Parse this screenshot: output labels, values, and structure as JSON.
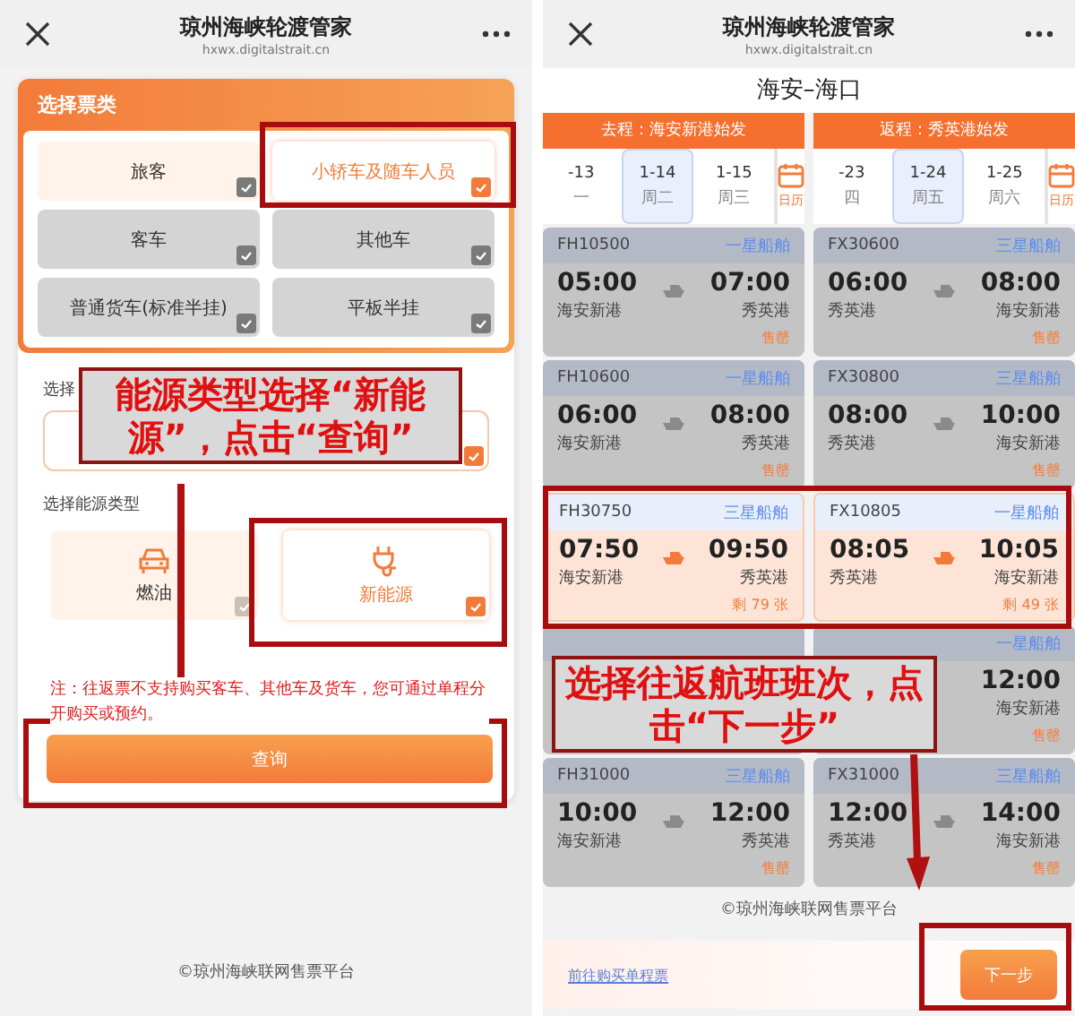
{
  "left": {
    "header": {
      "title": "琼州海峡轮渡管家",
      "subtitle": "hxwx.digitalstrait.cn"
    },
    "ticket_section": {
      "title": "选择票类",
      "options": [
        {
          "label": "旅客",
          "selected": false,
          "disabled": false
        },
        {
          "label": "小轿车及随车人员",
          "selected": true,
          "disabled": false
        },
        {
          "label": "客车",
          "selected": false,
          "disabled": true
        },
        {
          "label": "其他车",
          "selected": false,
          "disabled": true
        },
        {
          "label": "普通货车(标准半挂)",
          "selected": false,
          "disabled": true
        },
        {
          "label": "平板半挂",
          "selected": false,
          "disabled": true
        }
      ]
    },
    "vehicle_label": "选择",
    "energy_label": "选择能源类型",
    "energy_options": [
      {
        "kind": "fuel",
        "label": "燃油",
        "selected": false
      },
      {
        "kind": "electric",
        "label": "新能源",
        "selected": true
      }
    ],
    "note": "注：往返票不支持购买客车、其他车及货车，您可通过单程分开购买或预约。",
    "query_button": "查询",
    "footer": "©琼州海峡联网售票平台"
  },
  "right": {
    "header": {
      "title": "琼州海峡轮渡管家",
      "subtitle": "hxwx.digitalstrait.cn"
    },
    "route_title": "海安–海口",
    "columns": [
      {
        "route": "去程：海安新港始发",
        "calendar": "日历",
        "dates": [
          {
            "date": "-13",
            "weekday": "一",
            "selected": false
          },
          {
            "date": "1-14",
            "weekday": "周二",
            "selected": true
          },
          {
            "date": "1-15",
            "weekday": "周三",
            "selected": false
          }
        ],
        "trips": [
          {
            "number": "FH10500",
            "grade": "一星船舶",
            "depart_time": "05:00",
            "depart_port": "海安新港",
            "arrive_time": "07:00",
            "arrive_port": "秀英港",
            "status": "售罄",
            "sold_out": true,
            "selected": false
          },
          {
            "number": "FH10600",
            "grade": "一星船舶",
            "depart_time": "06:00",
            "depart_port": "海安新港",
            "arrive_time": "08:00",
            "arrive_port": "秀英港",
            "status": "售罄",
            "sold_out": true,
            "selected": false
          },
          {
            "number": "FH30750",
            "grade": "三星船舶",
            "depart_time": "07:50",
            "depart_port": "海安新港",
            "arrive_time": "09:50",
            "arrive_port": "秀英港",
            "status": "剩 79 张",
            "sold_out": false,
            "selected": true
          },
          {
            "sold_out": true,
            "selected": false
          },
          {
            "number": "FH31000",
            "grade": "三星船舶",
            "depart_time": "10:00",
            "depart_port": "海安新港",
            "arrive_time": "12:00",
            "arrive_port": "秀英港",
            "status": "售罄",
            "sold_out": true,
            "selected": false
          }
        ]
      },
      {
        "route": "返程：秀英港始发",
        "calendar": "日历",
        "dates": [
          {
            "date": "-23",
            "weekday": "四",
            "selected": false
          },
          {
            "date": "1-24",
            "weekday": "周五",
            "selected": true
          },
          {
            "date": "1-25",
            "weekday": "周六",
            "selected": false
          }
        ],
        "trips": [
          {
            "number": "FX30600",
            "grade": "三星船舶",
            "depart_time": "06:00",
            "depart_port": "秀英港",
            "arrive_time": "08:00",
            "arrive_port": "海安新港",
            "status": "售罄",
            "sold_out": true,
            "selected": false
          },
          {
            "number": "FX30800",
            "grade": "三星船舶",
            "depart_time": "08:00",
            "depart_port": "秀英港",
            "arrive_time": "10:00",
            "arrive_port": "海安新港",
            "status": "售罄",
            "sold_out": true,
            "selected": false
          },
          {
            "number": "FX10805",
            "grade": "一星船舶",
            "depart_time": "08:05",
            "depart_port": "秀英港",
            "arrive_time": "10:05",
            "arrive_port": "海安新港",
            "status": "剩 49 张",
            "sold_out": false,
            "selected": true
          },
          {
            "grade": "一星船舶",
            "arrive_time": "12:00",
            "arrive_port": "海安新港",
            "status": "售罄",
            "sold_out": true,
            "selected": false
          },
          {
            "number": "FX31000",
            "grade": "三星船舶",
            "depart_time": "12:00",
            "depart_port": "秀英港",
            "arrive_time": "14:00",
            "arrive_port": "海安新港",
            "status": "售罄",
            "sold_out": true,
            "selected": false
          }
        ]
      }
    ],
    "footer": "©琼州海峡联网售票平台",
    "single_link": "前往购买单程票",
    "next_button": "下一步"
  },
  "annotations": [
    {
      "text": "能源类型选择“新能源”，点击“查询”"
    },
    {
      "text": "选择往返航班班次，点击“下一步”"
    }
  ]
}
